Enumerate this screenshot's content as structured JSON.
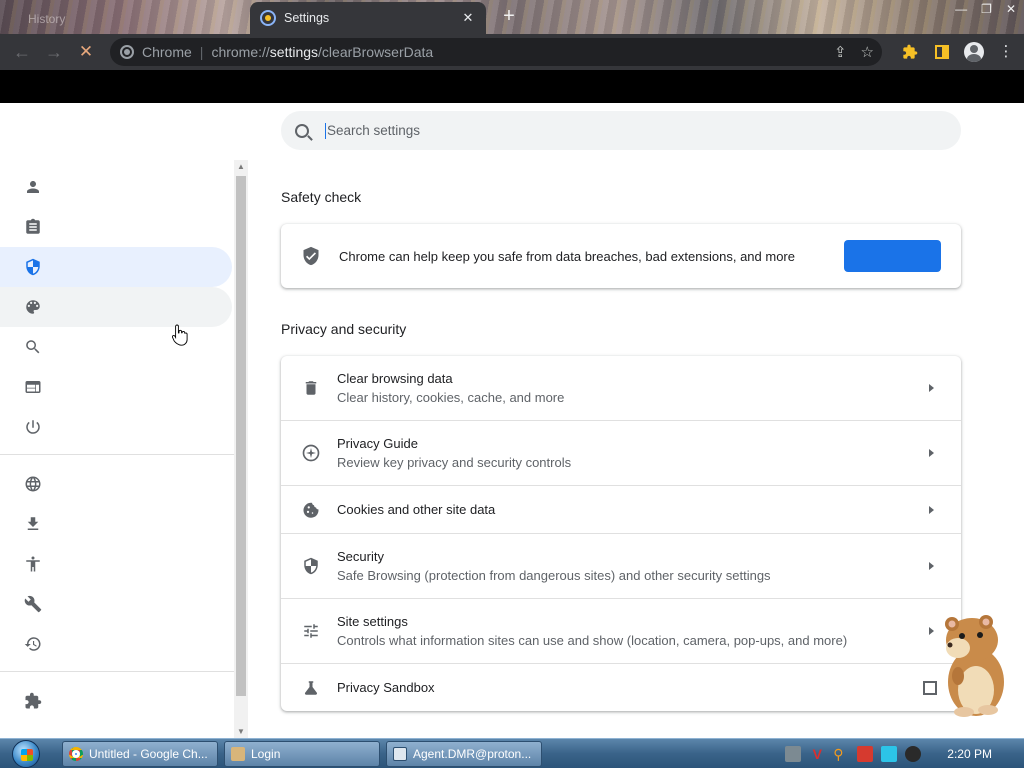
{
  "browser": {
    "tabs": [
      {
        "label": "History",
        "active": false
      },
      {
        "label": "Settings",
        "active": true
      }
    ],
    "new_tab_symbol": "+",
    "omnibox": {
      "site_label": "Chrome",
      "url_scheme": "chrome://",
      "url_host": "settings",
      "url_path": "/clearBrowserData"
    },
    "window_controls": [
      "minimize-icon",
      "maximize-icon",
      "close-icon"
    ]
  },
  "search": {
    "placeholder": "Search settings",
    "value": ""
  },
  "sidebar": {
    "items": [
      {
        "name": "you-and-google",
        "icon": "person-icon"
      },
      {
        "name": "autofill",
        "icon": "clipboard-icon"
      },
      {
        "name": "privacy-and-security",
        "icon": "shield-icon",
        "active": true
      },
      {
        "name": "appearance",
        "icon": "palette-icon",
        "hover": true
      },
      {
        "name": "search-engine",
        "icon": "search-icon"
      },
      {
        "name": "default-browser",
        "icon": "browser-window-icon"
      },
      {
        "name": "on-startup",
        "icon": "power-icon"
      },
      {
        "name": "languages",
        "icon": "globe-icon"
      },
      {
        "name": "downloads",
        "icon": "download-icon"
      },
      {
        "name": "accessibility",
        "icon": "accessibility-icon"
      },
      {
        "name": "system",
        "icon": "wrench-icon"
      },
      {
        "name": "reset-settings",
        "icon": "history-icon"
      },
      {
        "name": "extensions",
        "icon": "puzzle-icon"
      }
    ]
  },
  "safety_check": {
    "title": "Safety check",
    "description": "Chrome can help keep you safe from data breaches, bad extensions, and more",
    "button_label": ""
  },
  "privacy": {
    "title": "Privacy and security",
    "rows": [
      {
        "title": "Clear browsing data",
        "subtitle": "Clear history, cookies, cache, and more",
        "icon": "trash-icon"
      },
      {
        "title": "Privacy Guide",
        "subtitle": "Review key privacy and security controls",
        "icon": "compass-icon"
      },
      {
        "title": "Cookies and other site data",
        "subtitle": "",
        "icon": "cookie-icon"
      },
      {
        "title": "Security",
        "subtitle": "Safe Browsing (protection from dangerous sites) and other security settings",
        "icon": "shield-icon"
      },
      {
        "title": "Site settings",
        "subtitle": "Controls what information sites can use and show (location, camera, pop-ups, and more)",
        "icon": "tune-icon"
      },
      {
        "title": "Privacy Sandbox",
        "subtitle": "",
        "icon": "flask-icon"
      }
    ]
  },
  "taskbar": {
    "tasks": [
      {
        "label": "Untitled - Google Ch...",
        "icon": "chrome-icon"
      },
      {
        "label": "Login",
        "icon": "app-icon"
      },
      {
        "label": "Agent.DMR@proton...",
        "icon": "window-icon"
      }
    ],
    "clock": "2:20 PM"
  }
}
